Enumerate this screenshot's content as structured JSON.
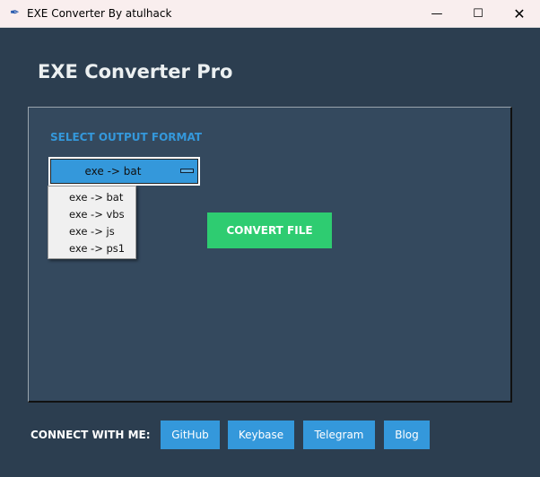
{
  "window": {
    "title": "EXE Converter By atulhack",
    "icon": "feather-icon",
    "controls": [
      "minimize",
      "maximize",
      "close"
    ]
  },
  "app": {
    "title": "EXE Converter Pro"
  },
  "format": {
    "label": "SELECT OUTPUT FORMAT",
    "selected": "exe -> bat",
    "options": [
      "exe -> bat",
      "exe -> vbs",
      "exe -> js",
      "exe -> ps1"
    ]
  },
  "convert": {
    "label": "CONVERT FILE"
  },
  "footer": {
    "label": "CONNECT WITH ME:",
    "links": [
      "GitHub",
      "Keybase",
      "Telegram",
      "Blog"
    ]
  },
  "colors": {
    "background": "#2c3e50",
    "panel": "#34495e",
    "accent": "#3498db",
    "convert": "#2ecc71"
  }
}
